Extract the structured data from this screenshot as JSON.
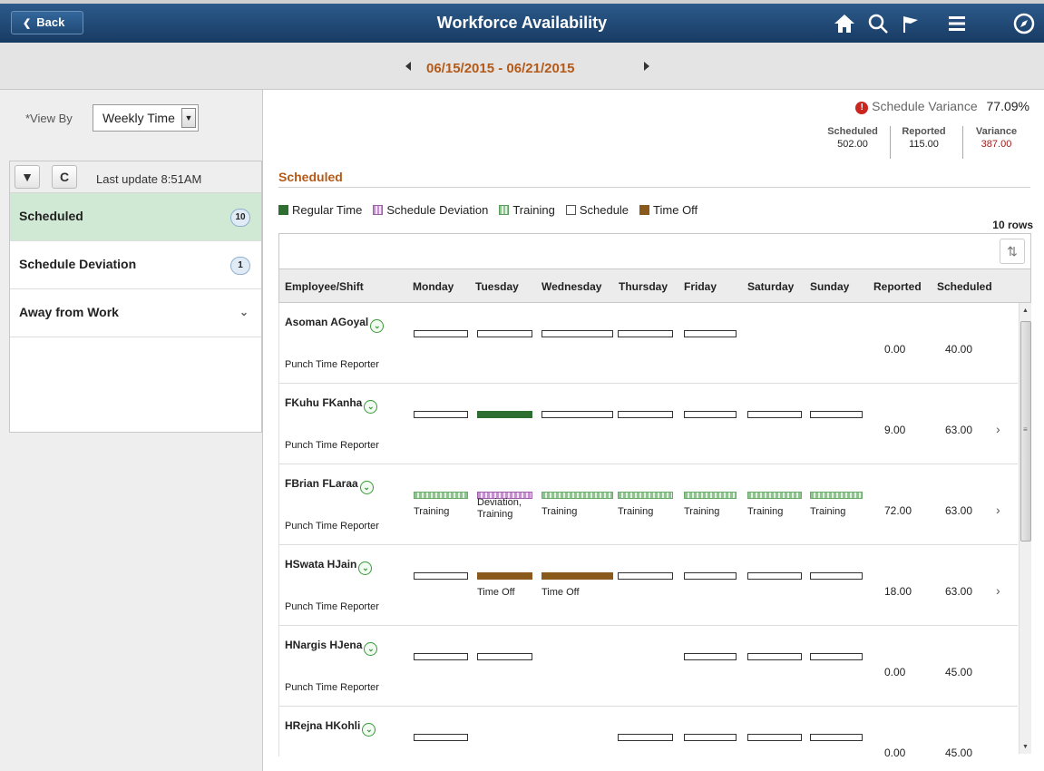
{
  "header": {
    "back_label": "Back",
    "title": "Workforce Availability",
    "icons": [
      "home-icon",
      "search-icon",
      "flag-icon",
      "menu-icon",
      "compass-icon"
    ]
  },
  "date_range": "06/15/2015 - 06/21/2015",
  "left": {
    "view_by_label": "*View By",
    "view_by_value": "Weekly Time",
    "last_update": "Last update 8:51AM",
    "items": [
      {
        "label": "Scheduled",
        "badge": "10",
        "selected": true
      },
      {
        "label": "Schedule Deviation",
        "badge": "1",
        "selected": false
      },
      {
        "label": "Away from Work",
        "badge": null,
        "selected": false
      }
    ]
  },
  "variance": {
    "title": "Schedule Variance",
    "percent": "77.09%",
    "scheduled_label": "Scheduled",
    "scheduled_value": "502.00",
    "reported_label": "Reported",
    "reported_value": "115.00",
    "variance_label": "Variance",
    "variance_value": "387.00",
    "variance_color": "#a01c1c"
  },
  "section_title": "Scheduled",
  "legend": [
    {
      "label": "Regular Time",
      "type": "reg"
    },
    {
      "label": "Schedule Deviation",
      "type": "dev"
    },
    {
      "label": "Training",
      "type": "trn"
    },
    {
      "label": "Schedule",
      "type": "sch"
    },
    {
      "label": "Time Off",
      "type": "off"
    }
  ],
  "rows_count": "10 rows",
  "columns": [
    "Employee/Shift",
    "Monday",
    "Tuesday",
    "Wednesday",
    "Thursday",
    "Friday",
    "Saturday",
    "Sunday",
    "Reported",
    "Scheduled"
  ],
  "rows": [
    {
      "name": "Asoman AGoyal",
      "role": "Punch Time Reporter",
      "reported": "0.00",
      "scheduled": "40.00",
      "chevron": false,
      "days": [
        {
          "t": "sch"
        },
        {
          "t": "sch"
        },
        {
          "t": "sch"
        },
        {
          "t": "sch"
        },
        {
          "t": "sch"
        },
        null,
        null
      ]
    },
    {
      "name": "FKuhu FKanha",
      "role": "Punch Time Reporter",
      "reported": "9.00",
      "scheduled": "63.00",
      "chevron": true,
      "days": [
        {
          "t": "sch"
        },
        {
          "t": "reg"
        },
        {
          "t": "sch"
        },
        {
          "t": "sch"
        },
        {
          "t": "sch"
        },
        {
          "t": "sch"
        },
        {
          "t": "sch"
        }
      ]
    },
    {
      "name": "FBrian FLaraa",
      "role": "Punch Time Reporter",
      "reported": "72.00",
      "scheduled": "63.00",
      "chevron": true,
      "days": [
        {
          "t": "trn",
          "label": "Training"
        },
        {
          "t": "dev",
          "label": "Deviation, Training"
        },
        {
          "t": "trn",
          "label": "Training"
        },
        {
          "t": "trn",
          "label": "Training"
        },
        {
          "t": "trn",
          "label": "Training"
        },
        {
          "t": "trn",
          "label": "Training"
        },
        {
          "t": "trn",
          "label": "Training"
        }
      ]
    },
    {
      "name": "HSwata HJain",
      "role": "Punch Time Reporter",
      "reported": "18.00",
      "scheduled": "63.00",
      "chevron": true,
      "days": [
        {
          "t": "sch"
        },
        {
          "t": "off",
          "label": "Time Off"
        },
        {
          "t": "off",
          "label": "Time Off"
        },
        {
          "t": "sch"
        },
        {
          "t": "sch"
        },
        {
          "t": "sch"
        },
        {
          "t": "sch"
        }
      ]
    },
    {
      "name": "HNargis HJena",
      "role": "Punch Time Reporter",
      "reported": "0.00",
      "scheduled": "45.00",
      "chevron": false,
      "days": [
        {
          "t": "sch"
        },
        {
          "t": "sch"
        },
        null,
        null,
        {
          "t": "sch"
        },
        {
          "t": "sch"
        },
        {
          "t": "sch"
        }
      ]
    },
    {
      "name": "HRejna HKohli",
      "role": "Punch Time Reporter",
      "reported": "0.00",
      "scheduled": "45.00",
      "chevron": false,
      "days": [
        {
          "t": "sch"
        },
        null,
        null,
        {
          "t": "sch"
        },
        {
          "t": "sch"
        },
        {
          "t": "sch"
        },
        {
          "t": "sch"
        }
      ]
    }
  ]
}
